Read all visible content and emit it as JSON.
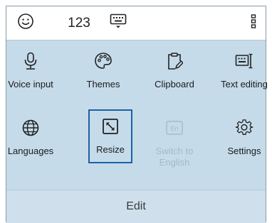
{
  "topbar": {
    "emoji_icon": "smiley-icon",
    "numbers_label": "123",
    "keyboard_icon": "keyboard-hide-icon",
    "more_icon": "more-vertical-icon"
  },
  "grid": [
    {
      "label": "Voice input",
      "icon": "microphone-icon"
    },
    {
      "label": "Themes",
      "icon": "palette-icon"
    },
    {
      "label": "Clipboard",
      "icon": "clipboard-icon"
    },
    {
      "label": "Text editing",
      "icon": "text-edit-icon"
    },
    {
      "label": "Languages",
      "icon": "globe-icon"
    },
    {
      "label": "Resize",
      "icon": "resize-icon"
    },
    {
      "label": "Switch to English",
      "icon": "en-icon",
      "badge": "En"
    },
    {
      "label": "Settings",
      "icon": "gear-icon"
    }
  ],
  "footer": {
    "label": "Edit"
  },
  "colors": {
    "panel": "#c5dbea",
    "selected_outline": "#1d5fa6",
    "disabled_text": "#a7b9c6"
  }
}
